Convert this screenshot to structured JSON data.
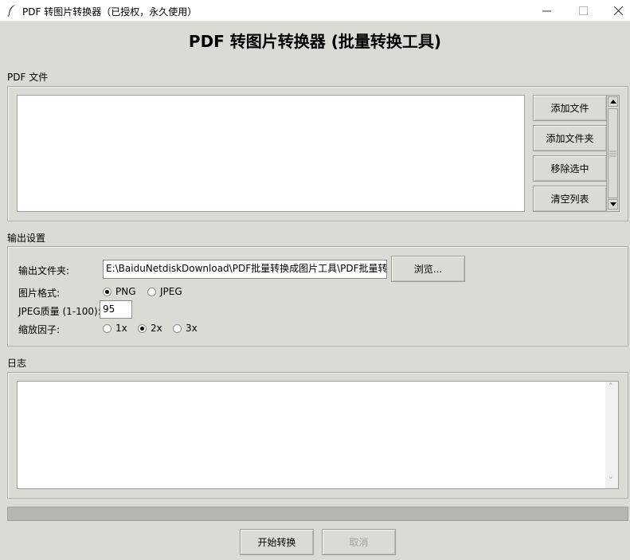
{
  "window": {
    "title": "PDF 转图片转换器（已授权，永久使用）",
    "min_glyph": "—",
    "max_glyph": "☐",
    "close_glyph": "✕"
  },
  "heading": "PDF 转图片转换器 (批量转换工具)",
  "pdf_files": {
    "label": "PDF 文件",
    "buttons": {
      "add_file": "添加文件",
      "add_folder": "添加文件夹",
      "remove_selected": "移除选中",
      "clear_list": "清空列表"
    },
    "up_arrow": "▲",
    "down_arrow": "▼"
  },
  "output": {
    "label": "输出设置",
    "folder_label": "输出文件夹:",
    "folder_value": "E:\\BaiduNetdiskDownload\\PDF批量转换成图片工具\\PDF批量转",
    "browse": "浏览...",
    "format_label": "图片格式:",
    "format_options": [
      "PNG",
      "JPEG"
    ],
    "format_selected": "PNG",
    "quality_label": "JPEG质量 (1-100):",
    "quality_value": "95",
    "scale_label": "缩放因子:",
    "scale_options": [
      "1x",
      "2x",
      "3x"
    ],
    "scale_selected": "2x"
  },
  "log": {
    "label": "日志",
    "up_arrow": "˄",
    "down_arrow": "˅"
  },
  "progress": {
    "value": 0
  },
  "actions": {
    "start": "开始转换",
    "cancel": "取消"
  }
}
